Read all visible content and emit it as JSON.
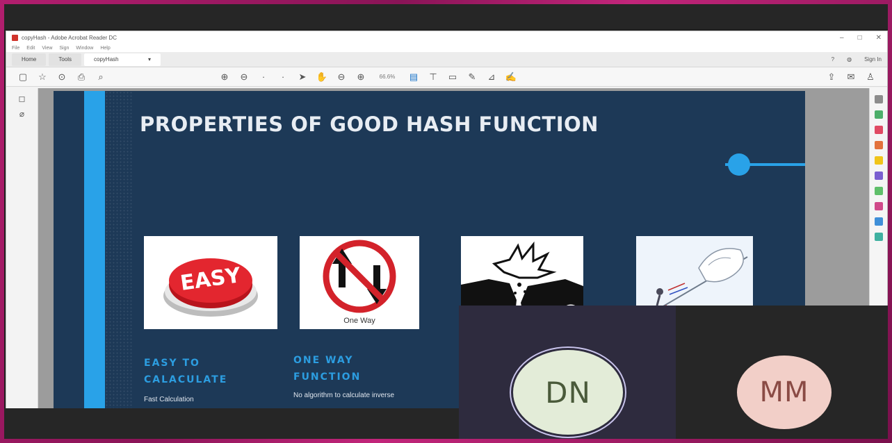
{
  "app": {
    "window_title": "copyHash - Adobe Acrobat Reader DC",
    "menu": [
      "File",
      "Edit",
      "View",
      "Sign",
      "Window",
      "Help"
    ],
    "tabs": {
      "home": "Home",
      "tools": "Tools",
      "document": "copyHash"
    },
    "sign_in": "Sign In",
    "zoom": "66.6%"
  },
  "slide": {
    "title": "PROPERTIES OF GOOD HASH FUNCTION",
    "items": [
      {
        "heading": "EASY TO CALACULATE",
        "description": "Fast Calculation",
        "image": "easy-button"
      },
      {
        "heading": "ONE WAY FUNCTION",
        "description": "No algorithm to calculate inverse",
        "image": "one-way-sign",
        "caption": "One Way"
      },
      {
        "image": "car-collision"
      },
      {
        "image": "avalanche-skier"
      }
    ],
    "easy_button_text": "EASY"
  },
  "participants": [
    {
      "initials": "DN",
      "color": "#e3ecd8"
    },
    {
      "initials": "MM",
      "color": "#f2cfc8"
    }
  ],
  "colors": {
    "slide_bg": "#1d3957",
    "accent": "#29a2e8",
    "frame": "#b21e6e"
  }
}
